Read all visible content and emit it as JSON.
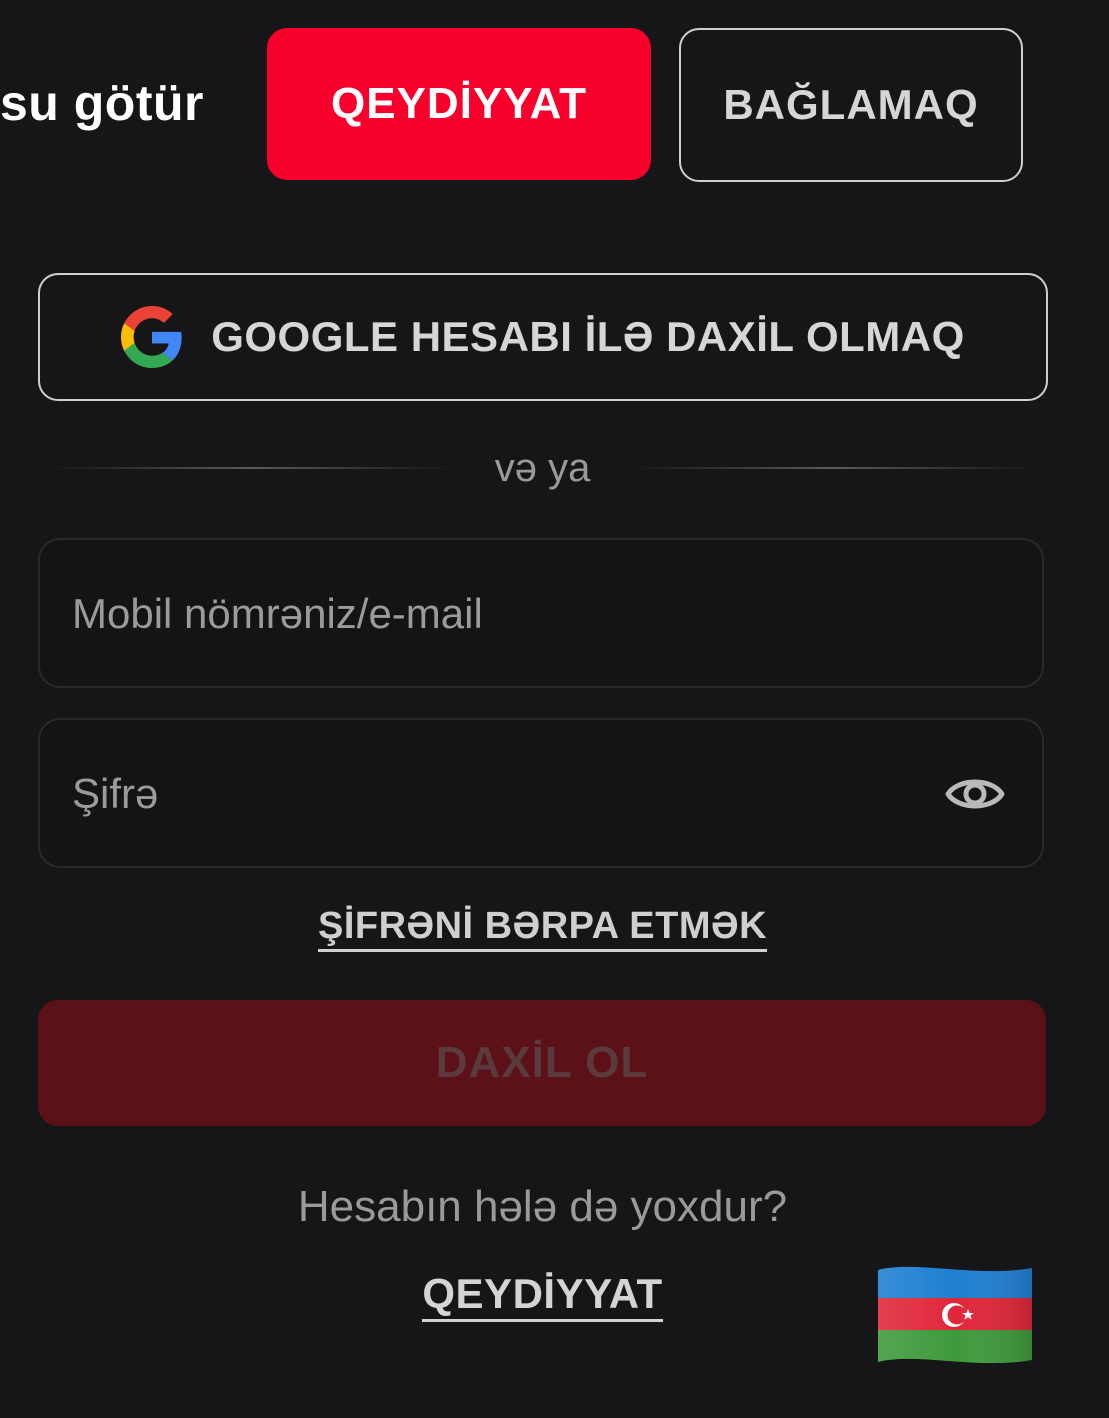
{
  "header": {
    "title_fragment": "su götür",
    "register_label": "QEYDİYYAT",
    "close_label": "BAĞLAMAQ"
  },
  "google": {
    "label": "GOOGLE HESABI İLƏ DAXİL OLMAQ",
    "icon": "google-g-icon"
  },
  "divider": {
    "text": "və ya"
  },
  "form": {
    "login": {
      "placeholder": "Mobil nömrəniz/e-mail",
      "value": ""
    },
    "password": {
      "placeholder": "Şifrə",
      "value": "",
      "icon": "eye-icon"
    },
    "forgot_label": "ŞİFRƏNİ BƏRPA ETMƏK",
    "submit_label": "DAXİL OL"
  },
  "footer": {
    "no_account_text": "Hesabın hələ də yoxdur?",
    "register_link_label": "QEYDİYYAT",
    "language_icon": "azerbaijan-flag-icon"
  },
  "colors": {
    "background": "#161618",
    "primary_red": "#f7002b",
    "disabled_red": "#5c1017",
    "border_light": "#cfcfcf",
    "text_muted": "#9a9a9a"
  }
}
